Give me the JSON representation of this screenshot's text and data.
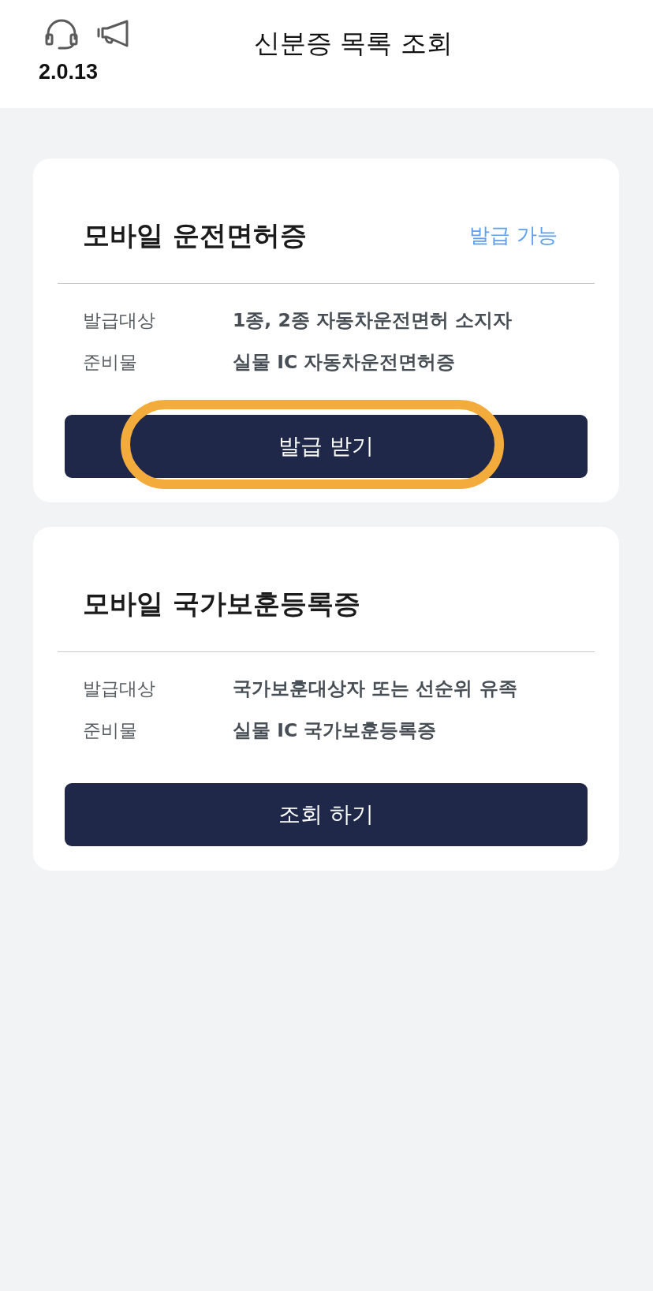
{
  "header": {
    "version": "2.0.13",
    "title": "신분증 목록 조회"
  },
  "cards": [
    {
      "title": "모바일 운전면허증",
      "status": "발급 가능",
      "details": [
        {
          "label": "발급대상",
          "value": "1종, 2종 자동차운전면허 소지자"
        },
        {
          "label": "준비물",
          "value": "실물 IC 자동차운전면허증"
        }
      ],
      "button": {
        "label": "발급 받기",
        "highlighted": true
      }
    },
    {
      "title": "모바일 국가보훈등록증",
      "details": [
        {
          "label": "발급대상",
          "value": "국가보훈대상자 또는 선순위 유족"
        },
        {
          "label": "준비물",
          "value": "실물 IC 국가보훈등록증"
        }
      ],
      "button": {
        "label": "조회 하기",
        "highlighted": false
      }
    }
  ]
}
